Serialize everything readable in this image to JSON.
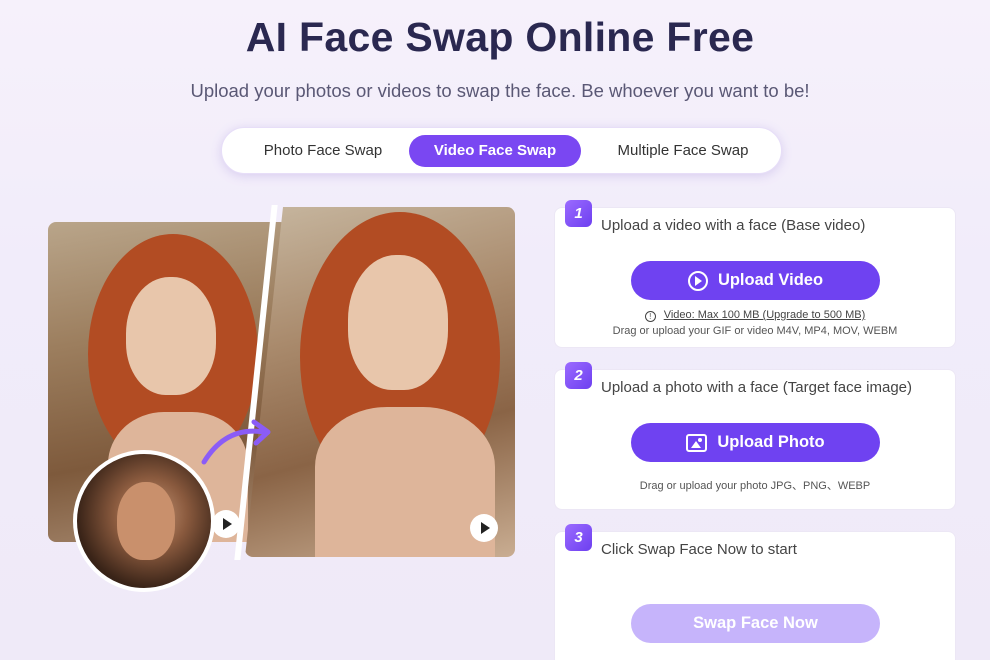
{
  "header": {
    "title": "AI Face Swap Online Free",
    "subtitle": "Upload your photos or videos to swap the face. Be whoever you want to be!"
  },
  "tabs": [
    {
      "label": "Photo Face Swap",
      "active": false
    },
    {
      "label": "Video Face Swap",
      "active": true
    },
    {
      "label": "Multiple Face Swap",
      "active": false
    }
  ],
  "steps": [
    {
      "number": "1",
      "text": "Upload a video with a face (Base video)",
      "button_label": "Upload Video",
      "button_icon": "play-circle-icon",
      "limit_text": "Video: Max 100 MB (Upgrade to 500 MB)",
      "hint": "Drag or upload your GIF or video M4V, MP4, MOV, WEBM"
    },
    {
      "number": "2",
      "text": "Upload a photo with a face (Target face image)",
      "button_label": "Upload Photo",
      "button_icon": "image-icon",
      "hint": "Drag or upload your photo JPG、PNG、WEBP"
    },
    {
      "number": "3",
      "text": "Click Swap Face Now to start",
      "button_label": "Swap Face Now"
    }
  ],
  "colors": {
    "accent": "#7a47f2",
    "accent_disabled": "#c6b4fb",
    "title": "#2a2850"
  }
}
